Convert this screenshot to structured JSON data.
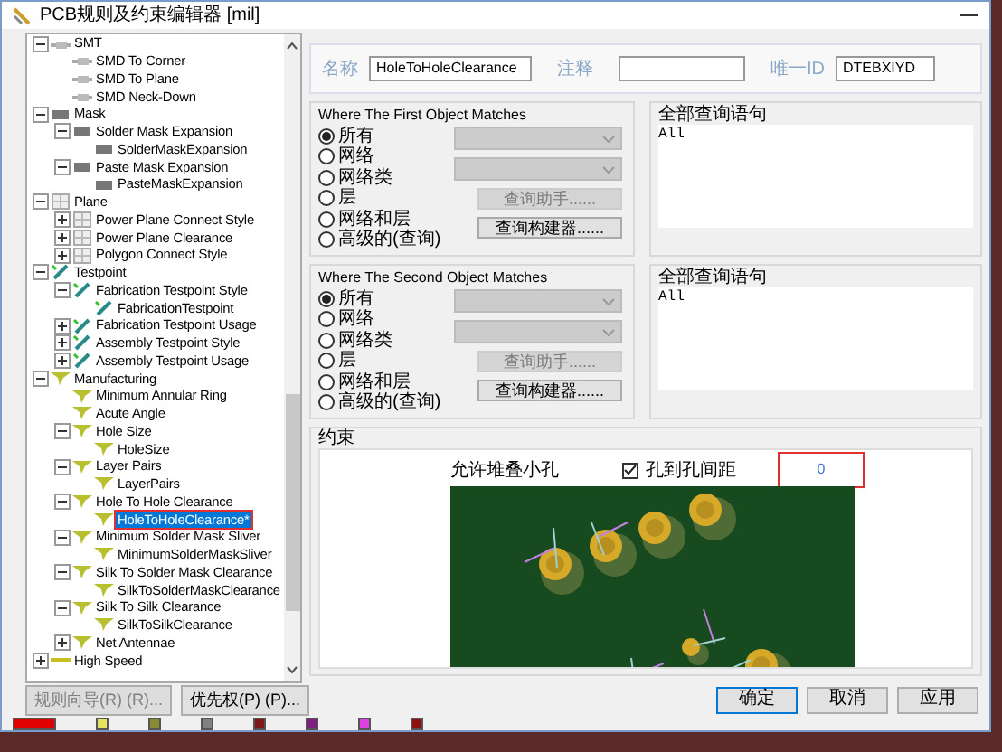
{
  "window": {
    "title": "PCB规则及约束编辑器 [mil]"
  },
  "tree": {
    "items": [
      {
        "label": "SMT",
        "kind": "smt",
        "expanded": true,
        "children": [
          {
            "label": "SMD To Corner"
          },
          {
            "label": "SMD To Plane"
          },
          {
            "label": "SMD Neck-Down"
          }
        ]
      },
      {
        "label": "Mask",
        "kind": "mask",
        "expanded": true,
        "children": [
          {
            "label": "Solder Mask Expansion",
            "expanded": true,
            "children": [
              {
                "label": "SolderMaskExpansion"
              }
            ]
          },
          {
            "label": "Paste Mask Expansion",
            "expanded": true,
            "children": [
              {
                "label": "PasteMaskExpansion"
              }
            ]
          }
        ]
      },
      {
        "label": "Plane",
        "kind": "plane",
        "expanded": true,
        "children": [
          {
            "label": "Power Plane Connect Style",
            "expanded": false
          },
          {
            "label": "Power Plane Clearance",
            "expanded": false
          },
          {
            "label": "Polygon Connect Style",
            "expanded": false
          }
        ]
      },
      {
        "label": "Testpoint",
        "kind": "testpoint",
        "expanded": true,
        "children": [
          {
            "label": "Fabrication Testpoint Style",
            "expanded": true,
            "children": [
              {
                "label": "FabricationTestpoint"
              }
            ]
          },
          {
            "label": "Fabrication Testpoint Usage",
            "expanded": false
          },
          {
            "label": "Assembly Testpoint Style",
            "expanded": false
          },
          {
            "label": "Assembly Testpoint Usage",
            "expanded": false
          }
        ]
      },
      {
        "label": "Manufacturing",
        "kind": "manufacturing",
        "expanded": true,
        "children": [
          {
            "label": "Minimum Annular Ring"
          },
          {
            "label": "Acute Angle"
          },
          {
            "label": "Hole Size",
            "expanded": true,
            "children": [
              {
                "label": "HoleSize"
              }
            ]
          },
          {
            "label": "Layer Pairs",
            "expanded": true,
            "children": [
              {
                "label": "LayerPairs"
              }
            ]
          },
          {
            "label": "Hole To Hole Clearance",
            "expanded": true,
            "children": [
              {
                "label": "HoleToHoleClearance*",
                "selected": true
              }
            ]
          },
          {
            "label": "Minimum Solder Mask Sliver",
            "expanded": true,
            "children": [
              {
                "label": "MinimumSolderMaskSliver"
              }
            ]
          },
          {
            "label": "Silk To Solder Mask Clearance",
            "expanded": true,
            "children": [
              {
                "label": "SilkToSolderMaskClearance"
              }
            ]
          },
          {
            "label": "Silk To Silk Clearance",
            "expanded": true,
            "children": [
              {
                "label": "SilkToSilkClearance"
              }
            ]
          },
          {
            "label": "Net Antennae",
            "expanded": false
          }
        ]
      },
      {
        "label": "High Speed",
        "kind": "highspeed",
        "expanded": false
      }
    ]
  },
  "rule": {
    "name_label": "名称",
    "name": "HoleToHoleClearance",
    "comment_label": "注释",
    "id_label": "唯一ID",
    "id": "DTEBXIYD"
  },
  "matches": [
    {
      "title": "Where The First Object Matches",
      "options": [
        {
          "label": "所有",
          "selected": true
        },
        {
          "label": "网络",
          "selected": false
        },
        {
          "label": "网络类",
          "selected": false
        },
        {
          "label": "层",
          "selected": false
        },
        {
          "label": "网络和层",
          "selected": false
        },
        {
          "label": "高级的(查询)",
          "selected": false
        }
      ],
      "buttons": [
        {
          "label": "查询助手......",
          "disabled": true
        },
        {
          "label": "查询构建器......",
          "disabled": false
        }
      ],
      "query_title": "全部查询语句",
      "query": "All"
    },
    {
      "title": "Where The Second Object Matches",
      "options": [
        {
          "label": "所有",
          "selected": true
        },
        {
          "label": "网络",
          "selected": false
        },
        {
          "label": "网络类",
          "selected": false
        },
        {
          "label": "层",
          "selected": false
        },
        {
          "label": "网络和层",
          "selected": false
        },
        {
          "label": "高级的(查询)",
          "selected": false
        }
      ],
      "buttons": [
        {
          "label": "查询助手......",
          "disabled": true
        },
        {
          "label": "查询构建器......",
          "disabled": false
        }
      ],
      "query_title": "全部查询语句",
      "query": "All"
    }
  ],
  "constraints": {
    "title": "约束",
    "stacked_label": "允许堆叠小孔",
    "clearance_label": "孔到孔间距",
    "checked": true,
    "value": "0"
  },
  "left_buttons": [
    {
      "label": "规则向导(R) (R)...",
      "disabled": true
    },
    {
      "label": "优先权(P) (P)...",
      "disabled": false
    }
  ],
  "buttons": [
    {
      "label": "确定",
      "default": true
    },
    {
      "label": "取消",
      "default": false
    },
    {
      "label": "应用",
      "default": false
    }
  ],
  "layer_tabs": [
    {
      "color": "#e00000"
    },
    {
      "color": "#e8e060"
    },
    {
      "color": "#8a8a30"
    },
    {
      "color": "#808080"
    },
    {
      "color": "#801818"
    },
    {
      "color": "#802080"
    },
    {
      "color": "#e040e0"
    },
    {
      "color": "#901010"
    }
  ]
}
